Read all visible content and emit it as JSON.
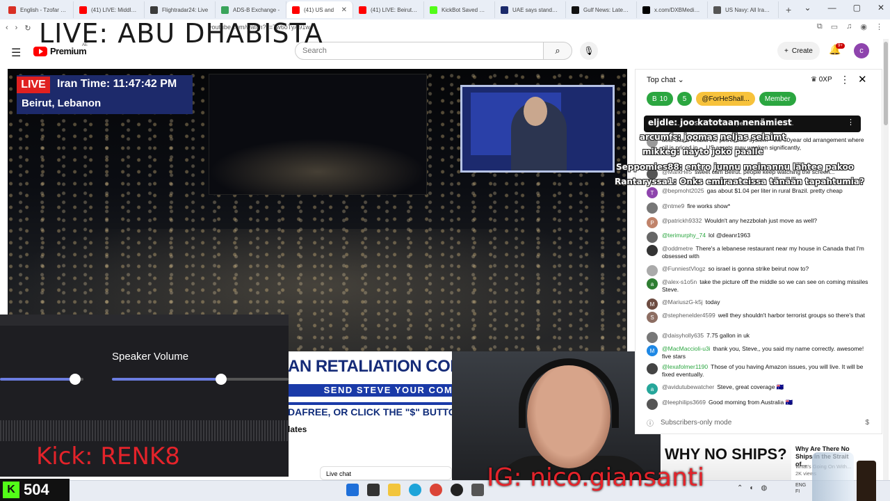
{
  "overlay": {
    "title": "LIVE: ABU DHABISTA",
    "kick_handle": "Kick: RENK8",
    "ig_handle": "IG: nico.giansanti",
    "kick_count": "504"
  },
  "browser": {
    "tabs": [
      {
        "label": "English - Tzofar - Re",
        "color": "#d93025"
      },
      {
        "label": "(41) LIVE: Middle Ea",
        "color": "#ff0000"
      },
      {
        "label": "Flightradar24: Live",
        "color": "#3b3b3b"
      },
      {
        "label": "ADS-B Exchange -",
        "color": "#3aa45b"
      },
      {
        "label": "(41) US and",
        "color": "#ff0000",
        "active": true
      },
      {
        "label": "(41) LIVE: Beirut sky",
        "color": "#ff0000"
      },
      {
        "label": "KickBot Saved Wid",
        "color": "#53fc18"
      },
      {
        "label": "UAE says stands for",
        "color": "#1a2a6b"
      },
      {
        "label": "Gulf News: Latest U",
        "color": "#111111"
      },
      {
        "label": "x.com/DXBMediaOf",
        "color": "#000000"
      },
      {
        "label": "US Navy: All Iranian",
        "color": "#555555"
      }
    ],
    "new_tab": "+",
    "url": "youtube.com/watch?v=Tw6oTyA91w"
  },
  "youtube": {
    "brand": "Premium",
    "region": "AE",
    "search_placeholder": "Search",
    "create_label": "Create",
    "notif_count": "9+",
    "avatar_letter": "c"
  },
  "video": {
    "live_badge": "LIVE",
    "iran_time": "Iran Time: 11:47:42 PM",
    "location": "Beirut, Lebanon",
    "headline": "AN RETALIATION CONTINUE",
    "subline": "SEND STEVE YOUR COMMENTS",
    "ticker": "DAFREE, OR CLICK THE \"$\" BUTTON AT THE",
    "updates": "lates",
    "live_chat_button": "Live chat"
  },
  "mixer": {
    "speaker_label": "Speaker Volume",
    "slider1_level": 0.9,
    "slider2_level": 0.62
  },
  "chat": {
    "header": "Top chat",
    "xp": "0XP",
    "chips": [
      {
        "label": "B",
        "extra": "10",
        "bg": "#2ba640"
      },
      {
        "label": "5",
        "extra": "",
        "bg": "#2ba640"
      },
      {
        "label": "@ForHeShall...",
        "extra": "",
        "bg": "#f7c23b"
      },
      {
        "label": "Member",
        "extra": "",
        "bg": "#2ba640"
      }
    ],
    "pinned": "MarkHe5 s... acts Saudi Arabia the petrodollar... /202595...",
    "overlay_taggers": [
      "eljdle: joo katotaan nenämiest",
      "arcumfs: joomas neljas selaimt",
      "mikkeg: nayto joko paalle",
      "Seppomies88: entro junnu meinannu lähtee pakoo",
      "Rantaryssa1: Onks emiraateissa tänään tapahtumia?"
    ],
    "messages": [
      {
        "author": "",
        "text": "acts Saudi Arabia the petrodollar system—the 50year old arrangement where oil is priced in ... US assets may weaken significantly,",
        "avatar": "#999"
      },
      {
        "author": "@MarkHe5",
        "text": "sweet cam Beirut. people keep watching the screen...",
        "avatar": "#555"
      },
      {
        "author": "@bepmoht2025",
        "text": "gas about $1.04 per liter in rural Brazil. pretty cheap",
        "avatar": "#8e44ad",
        "letter": "T"
      },
      {
        "author": "@ntme9",
        "text": "fire works show*",
        "avatar": "#777"
      },
      {
        "author": "@patrickh9332",
        "text": "Wouldn't any hezzbolah just move as well?",
        "avatar": "#c0836a",
        "letter": "P"
      },
      {
        "author": "@terimurphy_74",
        "text": "lol @deanr1963",
        "avatar": "#666",
        "member": true
      },
      {
        "author": "@oddmetre",
        "text": "There's a lebanese restaurant near my house in Canada that I'm obsessed with",
        "avatar": "#333"
      },
      {
        "author": "@FunniestVlogz",
        "text": "so israel is gonna strike beirut now to?",
        "avatar": "#aaa"
      },
      {
        "author": "@alex-s1o5n",
        "text": "take the picture off the middle so we can see on coming missiles Steve.",
        "avatar": "#2e7d32",
        "letter": "a"
      },
      {
        "author": "@MariuszG-k5j",
        "text": "today",
        "avatar": "#6d4c41",
        "letter": "M"
      },
      {
        "author": "@stephenelder4599",
        "text": "well they shouldn't harbor terrorist groups so there's that",
        "avatar": "#8d6e63",
        "letter": "S"
      },
      {
        "author": "@daisyholly635",
        "text": "7.75 gallon in uk",
        "avatar": "#777"
      },
      {
        "author": "@MacMaccioli-u3i",
        "text": "thank you, Steve,, you said my name correctly. awesome! five stars",
        "avatar": "#1e88e5",
        "letter": "M",
        "member": true
      },
      {
        "author": "@lexafolmer1190",
        "text": "Those of you having Amazon issues, you will live. It will be fixed eventually.",
        "avatar": "#444",
        "member": true
      },
      {
        "author": "@avidutubewatcher",
        "text": "Steve, great coverage 🇦🇺",
        "avatar": "#26a69a",
        "letter": "a"
      },
      {
        "author": "@leephilips3669",
        "text": "Good morning from Australia 🇦🇺",
        "avatar": "#555"
      }
    ],
    "subs_only": "Subscribers-only mode"
  },
  "related": {
    "thumb_text": "WHY NO SHIPS?",
    "title": "Why Are There No Ships in the Strait of...",
    "meta": "What's Going On With...\n2K views"
  },
  "taskbar": {
    "lang": "ENG",
    "region": "FI"
  }
}
